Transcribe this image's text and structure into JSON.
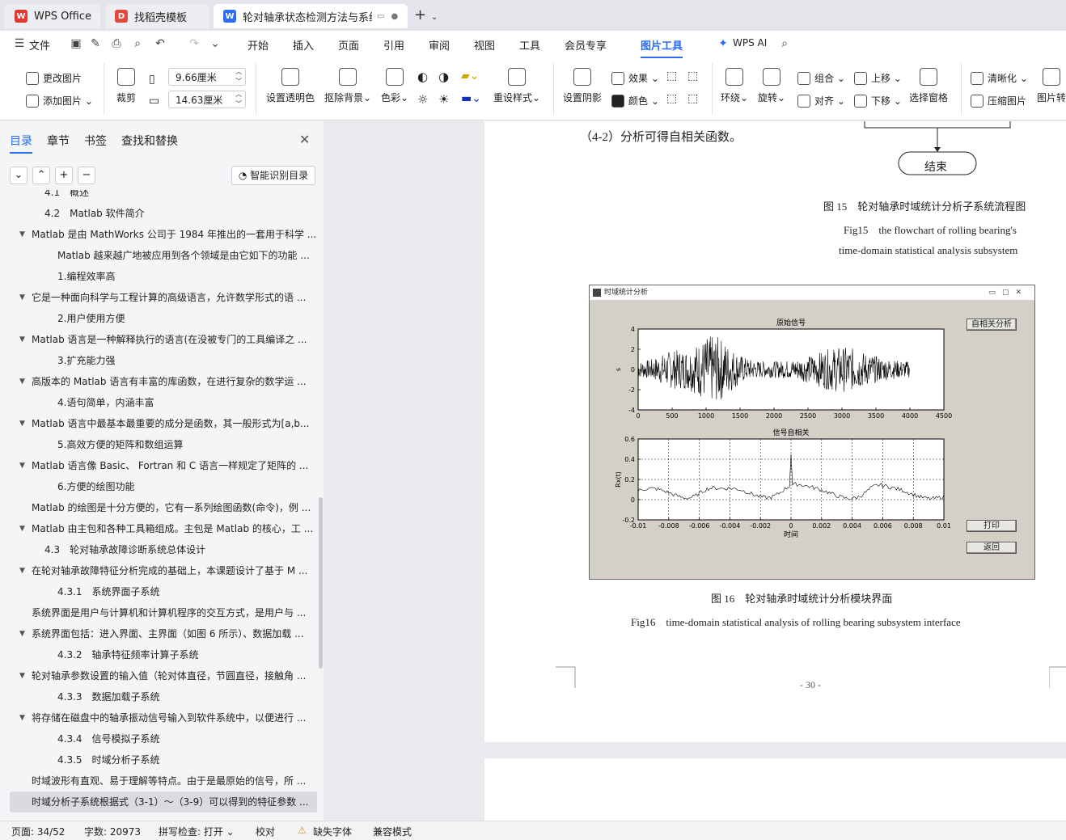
{
  "tabs": [
    {
      "label": "WPS Office",
      "logo": "W"
    },
    {
      "label": "找稻壳模板",
      "logo": "D"
    },
    {
      "label": "轮对轴承状态检测方法与系统",
      "logo": "W"
    }
  ],
  "menu": [
    "文件",
    "开始",
    "插入",
    "页面",
    "引用",
    "审阅",
    "视图",
    "工具",
    "会员专享",
    "图片工具",
    "WPS AI"
  ],
  "ribbon": {
    "change_pic": "更改图片",
    "add_pic": "添加图片",
    "crop": "裁剪",
    "width": "9.66厘米",
    "height": "14.63厘米",
    "set_transparent": "设置透明色",
    "remove_bg": "抠除背景",
    "color_effect": "色彩",
    "preset_style": "重设样式",
    "shadow": "设置阴影",
    "effect": "效果",
    "color": "颜色",
    "wrap": "环绕",
    "rotate": "旋转",
    "group": "组合",
    "align": "对齐",
    "move_up": "上移",
    "move_down": "下移",
    "select_pane": "选择窗格",
    "sharpen": "清晰化",
    "compress": "压缩图片",
    "pic_convert": "图片转"
  },
  "nav": {
    "tabs": [
      "目录",
      "章节",
      "书签",
      "查找和替换"
    ],
    "smart_btn": "智能识别目录",
    "items": [
      {
        "text": "4.1　概述",
        "indent": 2,
        "arrow": false
      },
      {
        "text": "4.2　Matlab 软件简介",
        "indent": 2,
        "arrow": false
      },
      {
        "text": "Matlab 是由 MathWorks 公司于 1984 年推出的一套用于科学 ...",
        "indent": 1,
        "arrow": true
      },
      {
        "text": "Matlab 越来越广地被应用到各个领域是由它如下的功能 ...",
        "indent": 3,
        "arrow": false
      },
      {
        "text": "1.编程效率高",
        "indent": 3,
        "arrow": false
      },
      {
        "text": "它是一种面向科学与工程计算的高级语言，允许数学形式的语 ...",
        "indent": 1,
        "arrow": true
      },
      {
        "text": "2.用户使用方便",
        "indent": 3,
        "arrow": false
      },
      {
        "text": "Matlab 语言是一种解释执行的语言(在没被专门的工具编译之 ...",
        "indent": 1,
        "arrow": true
      },
      {
        "text": "3.扩充能力强",
        "indent": 3,
        "arrow": false
      },
      {
        "text": "高版本的 Matlab 语言有丰富的库函数，在进行复杂的数学运 ...",
        "indent": 1,
        "arrow": true
      },
      {
        "text": "4.语句简单，内涵丰富",
        "indent": 3,
        "arrow": false
      },
      {
        "text": "Matlab 语言中最基本最重要的成分是函数，其一般形式为[a,b...",
        "indent": 1,
        "arrow": true
      },
      {
        "text": "5.高效方便的矩阵和数组运算",
        "indent": 3,
        "arrow": false
      },
      {
        "text": "Matlab 语言像 Basic、 Fortran 和 C 语言一样规定了矩阵的 ...",
        "indent": 1,
        "arrow": true
      },
      {
        "text": "6.方便的绘图功能",
        "indent": 3,
        "arrow": false
      },
      {
        "text": "Matlab 的绘图是十分方便的，它有一系列绘图函数(命令)，例 ...",
        "indent": 0,
        "arrow": false
      },
      {
        "text": "Matlab 由主包和各种工具箱组成。主包是 Matlab 的核心，工 ...",
        "indent": 1,
        "arrow": true
      },
      {
        "text": "4.3　轮对轴承故障诊断系统总体设计",
        "indent": 2,
        "arrow": false
      },
      {
        "text": "在轮对轴承故障特征分析完成的基础上，本课题设计了基于 M ...",
        "indent": 1,
        "arrow": true
      },
      {
        "text": "4.3.1　系统界面子系统",
        "indent": 3,
        "arrow": false
      },
      {
        "text": "系统界面是用户与计算机和计算机程序的交互方式，是用户与 ...",
        "indent": 0,
        "arrow": false
      },
      {
        "text": "系统界面包括：进入界面、主界面（如图 6 所示）、数据加载 ...",
        "indent": 1,
        "arrow": true
      },
      {
        "text": "4.3.2　轴承特征频率计算子系统",
        "indent": 3,
        "arrow": false
      },
      {
        "text": "轮对轴承参数设置的输入值（轮对体直径，节圆直径，接触角 ...",
        "indent": 1,
        "arrow": true
      },
      {
        "text": "4.3.3　数据加载子系统",
        "indent": 3,
        "arrow": false
      },
      {
        "text": "将存储在磁盘中的轴承振动信号输入到软件系统中，以便进行 ...",
        "indent": 1,
        "arrow": true
      },
      {
        "text": "4.3.4　信号模拟子系统",
        "indent": 3,
        "arrow": false
      },
      {
        "text": "4.3.5　时域分析子系统",
        "indent": 3,
        "arrow": false
      },
      {
        "text": "时域波形有直观、易于理解等特点。由于是最原始的信号，所 ...",
        "indent": 0,
        "arrow": false
      },
      {
        "text": "时域分析子系统根据式（3-1）～（3-9）可以得到的特征参数 ...",
        "indent": 0,
        "arrow": false,
        "selected": true
      }
    ]
  },
  "doc": {
    "line1": "（4-2）分析可得自相关函数。",
    "end_node": "结束",
    "fig15_cn": "图 15　轮对轴承时域统计分析子系统流程图",
    "fig15_en1": "Fig15　the flowchart of rolling bearing's",
    "fig15_en2": "time-domain statistical analysis subsystem",
    "fig16_cn": "图 16　轮对轴承时域统计分析模块界面",
    "fig16_en": "Fig16　time-domain statistical analysis of rolling bearing subsystem interface",
    "page_num": "- 30 -"
  },
  "matlab": {
    "window_title": "时域统计分析",
    "btn_autocorr": "自相关分析",
    "btn_print": "打印",
    "btn_return": "返回",
    "plot1_title": "原始信号",
    "plot1_ylabel": "s",
    "plot1_xticks": [
      "0",
      "500",
      "1000",
      "1500",
      "2000",
      "2500",
      "3000",
      "3500",
      "4000",
      "4500"
    ],
    "plot1_yticks": [
      "4",
      "2",
      "0",
      "-2",
      "-4"
    ],
    "plot2_title": "信号自相关",
    "plot2_ylabel": "Rx(t)",
    "plot2_xlabel": "时间",
    "plot2_xticks": [
      "-0.01",
      "-0.008",
      "-0.006",
      "-0.004",
      "-0.002",
      "0",
      "0.002",
      "0.004",
      "0.006",
      "0.008",
      "0.01"
    ],
    "plot2_yticks": [
      "0.6",
      "0.4",
      "0.2",
      "0",
      "-0.2"
    ]
  },
  "chart_data": [
    {
      "type": "line",
      "title": "原始信号",
      "xlabel": "",
      "ylabel": "s",
      "xlim": [
        0,
        4500
      ],
      "ylim": [
        -4,
        4
      ],
      "grid": false,
      "series": [
        {
          "values_desc": "noisy vibration signal, 4000 samples, amplitude roughly -3 to 3"
        }
      ]
    },
    {
      "type": "line",
      "title": "信号自相关",
      "xlabel": "时间",
      "ylabel": "Rx(t)",
      "xlim": [
        -0.01,
        0.01
      ],
      "ylim": [
        -0.2,
        0.6
      ],
      "grid": true,
      "series": [
        {
          "values_desc": "autocorrelation with peak ~0.45 at 0, fluctuating around 0 to 0.15"
        }
      ]
    }
  ],
  "status": {
    "page": "页面: 34/52",
    "words": "字数: 20973",
    "spell": "拼写检查: 打开",
    "proof": "校对",
    "missing_font": "缺失字体",
    "compat": "兼容模式"
  }
}
